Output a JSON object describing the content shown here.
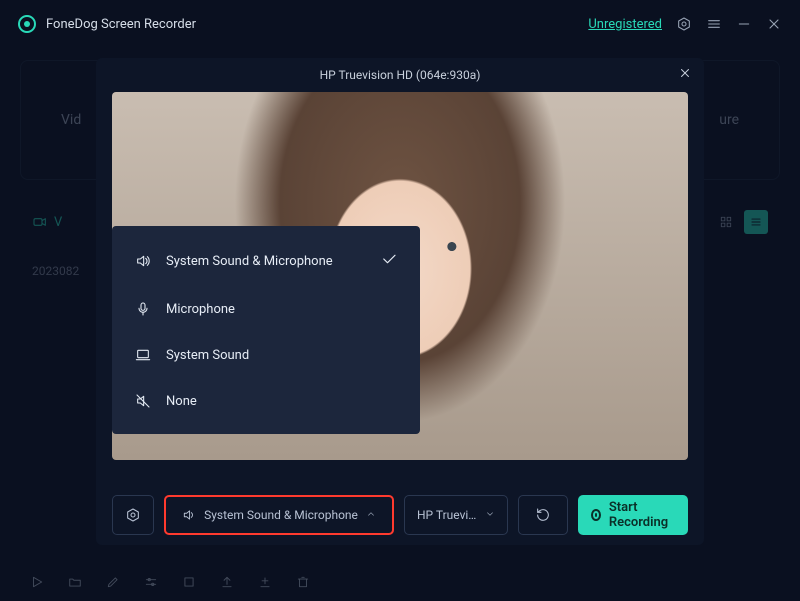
{
  "title_bar": {
    "app_name": "FoneDog Screen Recorder",
    "registration_status": "Unregistered"
  },
  "background": {
    "left_tab": "Vid",
    "right_tab": "ure",
    "cam_label": "V",
    "datestamp": "2023082"
  },
  "modal": {
    "device_title": "HP Truevision HD (064e:930a)"
  },
  "audio_menu": {
    "items": [
      {
        "icon": "speaker-icon",
        "label": "System Sound & Microphone",
        "selected": true
      },
      {
        "icon": "microphone-icon",
        "label": "Microphone",
        "selected": false
      },
      {
        "icon": "laptop-icon",
        "label": "System Sound",
        "selected": false
      },
      {
        "icon": "speaker-muted-icon",
        "label": "None",
        "selected": false
      }
    ]
  },
  "controls": {
    "audio_selection": "System Sound & Microphone",
    "device_selection": "HP Truevi...",
    "record_button": "Start Recording"
  }
}
